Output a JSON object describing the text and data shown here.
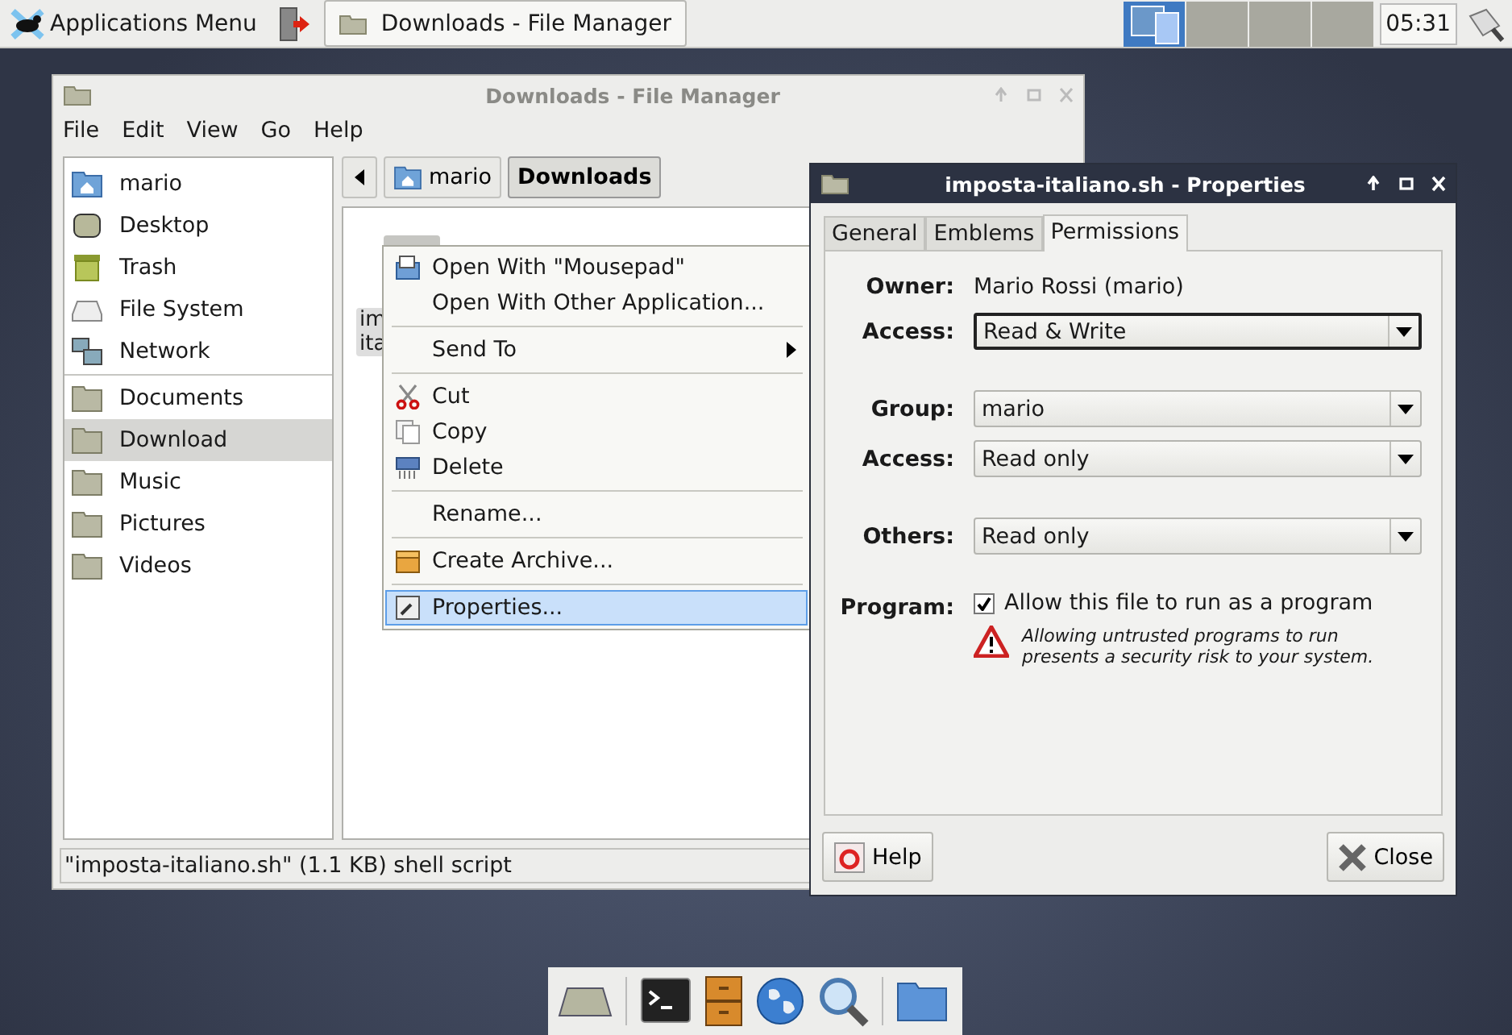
{
  "top_panel": {
    "app_menu": "Applications Menu",
    "tasks": [
      {
        "title": "Downloads - File Manager",
        "selected": true
      }
    ],
    "workspaces": [
      {
        "selected": true
      },
      {
        "selected": false
      },
      {
        "selected": false
      },
      {
        "selected": false
      }
    ],
    "clock": "05:31"
  },
  "file_manager": {
    "title": "Downloads - File Manager",
    "menu": [
      "File",
      "Edit",
      "View",
      "Go",
      "Help"
    ],
    "sidebar": [
      [
        {
          "label": "mario",
          "kind": "home",
          "selected": false
        },
        {
          "label": "Desktop",
          "kind": "desktop",
          "selected": false
        },
        {
          "label": "Trash",
          "kind": "trash",
          "selected": false
        },
        {
          "label": "File System",
          "kind": "drive",
          "selected": false
        },
        {
          "label": "Network",
          "kind": "network",
          "selected": false
        }
      ],
      [
        {
          "label": "Documents",
          "kind": "folder",
          "selected": false
        },
        {
          "label": "Download",
          "kind": "folder",
          "selected": true
        },
        {
          "label": "Music",
          "kind": "folder",
          "selected": false
        },
        {
          "label": "Pictures",
          "kind": "folder",
          "selected": false
        },
        {
          "label": "Videos",
          "kind": "folder",
          "selected": false
        }
      ]
    ],
    "path": [
      {
        "label": "mario",
        "kind": "home",
        "selected": false
      },
      {
        "label": "Downloads",
        "kind": "plain",
        "selected": true
      }
    ],
    "file_label": [
      "im",
      "ita"
    ],
    "status": "\"imposta-italiano.sh\" (1.1 KB) shell script"
  },
  "context_menu": [
    [
      {
        "label": "Open With \"Mousepad\"",
        "kind": "editor",
        "submenu": false,
        "selected": false
      },
      {
        "label": "Open With Other Application...",
        "kind": "none",
        "submenu": false,
        "selected": false
      }
    ],
    [
      {
        "label": "Send To",
        "kind": "none",
        "submenu": true,
        "selected": false
      }
    ],
    [
      {
        "label": "Cut",
        "kind": "cut",
        "submenu": false,
        "selected": false
      },
      {
        "label": "Copy",
        "kind": "copy",
        "submenu": false,
        "selected": false
      },
      {
        "label": "Delete",
        "kind": "delete",
        "submenu": false,
        "selected": false
      }
    ],
    [
      {
        "label": "Rename...",
        "kind": "none",
        "submenu": false,
        "selected": false
      }
    ],
    [
      {
        "label": "Create Archive...",
        "kind": "archive",
        "submenu": false,
        "selected": false
      }
    ],
    [
      {
        "label": "Properties...",
        "kind": "properties",
        "submenu": false,
        "selected": true
      }
    ]
  ],
  "properties": {
    "title": "imposta-italiano.sh - Properties",
    "tabs": [
      {
        "label": "General",
        "selected": false
      },
      {
        "label": "Emblems",
        "selected": false
      },
      {
        "label": "Permissions",
        "selected": true
      }
    ],
    "owner": {
      "label": "Owner:",
      "value": "Mario Rossi (mario)"
    },
    "rows": [
      {
        "label": "Access:",
        "value": "Read & Write",
        "focused": true
      },
      {
        "label": "Group:",
        "value": "mario",
        "focused": false
      },
      {
        "label": "Access:",
        "value": "Read only",
        "focused": false
      },
      {
        "label": "Others:",
        "value": "Read only",
        "focused": false
      }
    ],
    "program": {
      "label": "Program:",
      "checkbox": "Allow this file to run as a program",
      "checked": true,
      "warning": "Allowing untrusted programs to run presents a security risk to your system."
    },
    "buttons": [
      {
        "label": "Help",
        "kind": "help"
      },
      {
        "label": "Close",
        "kind": "close"
      }
    ]
  }
}
